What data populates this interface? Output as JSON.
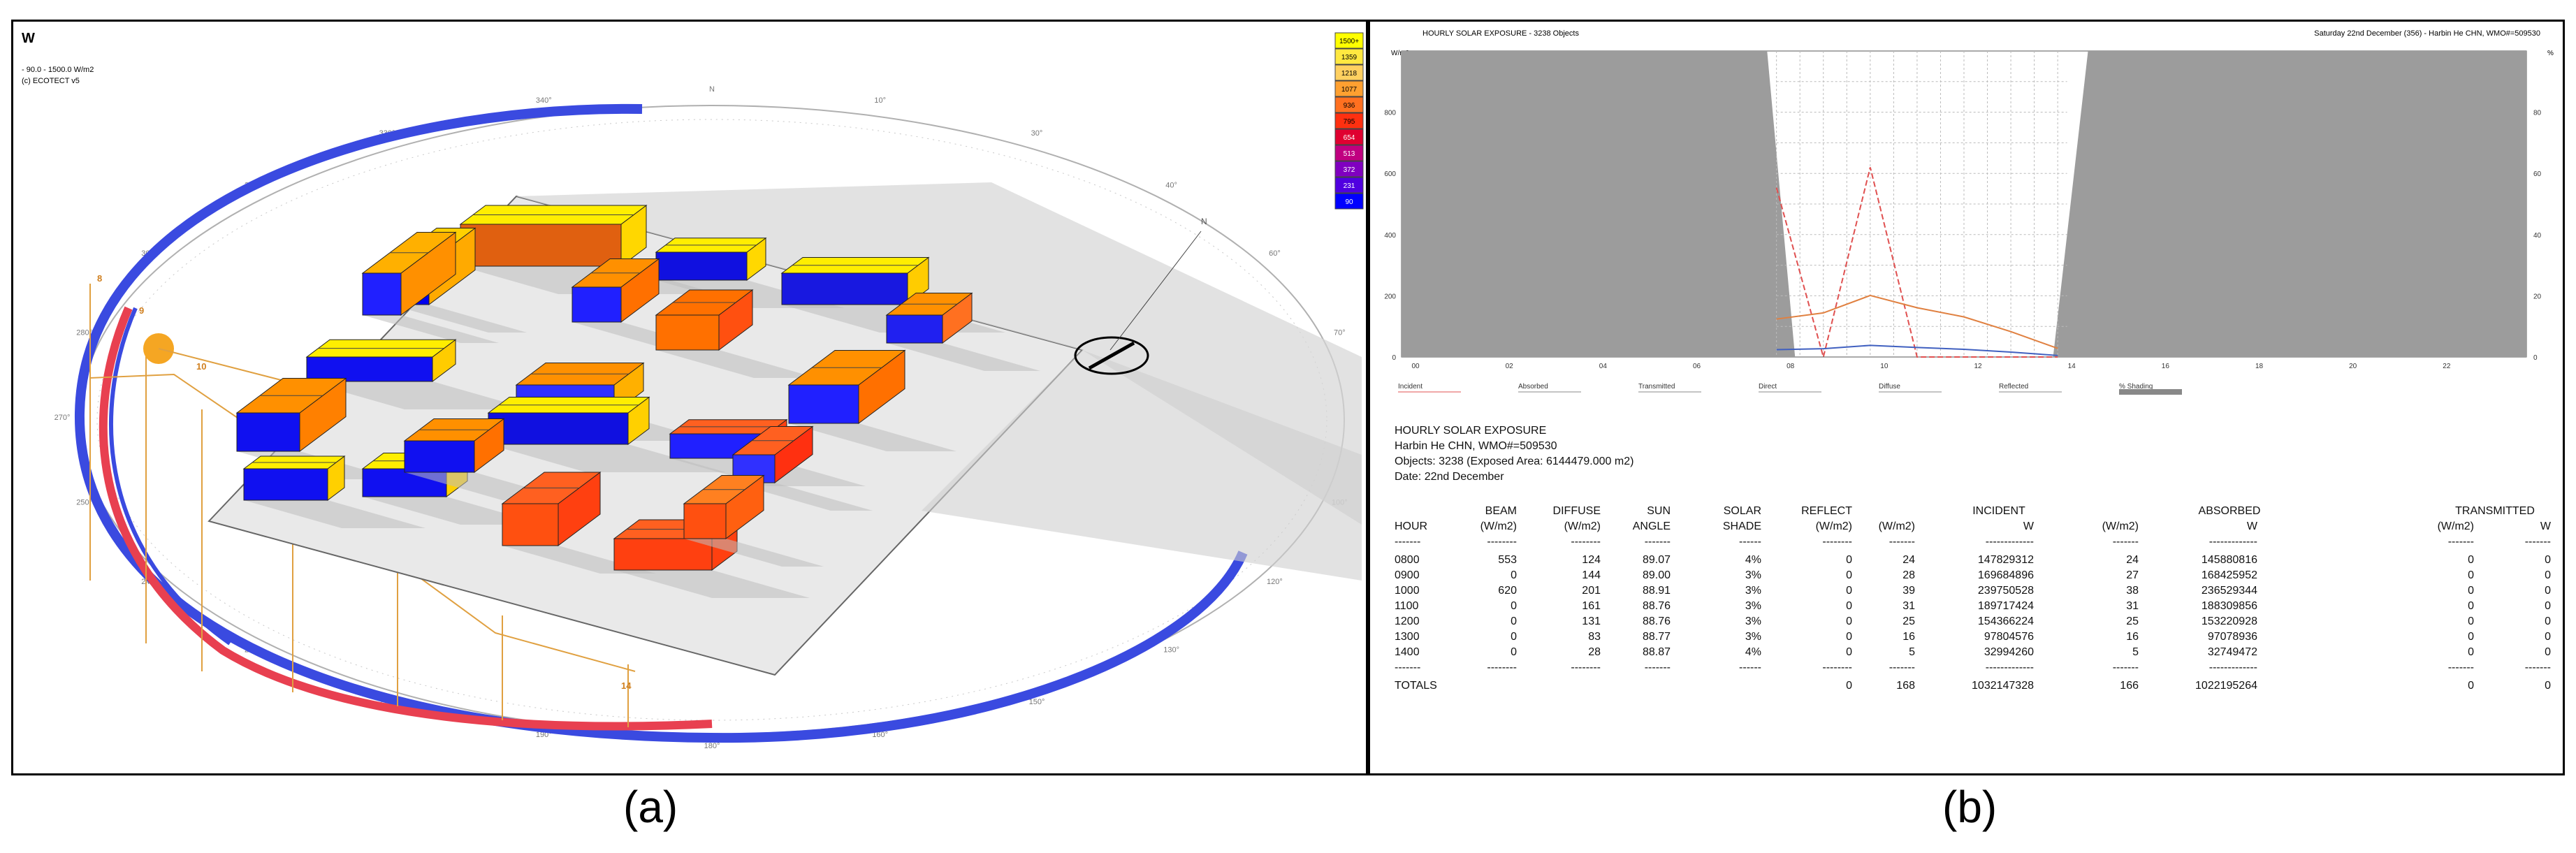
{
  "panel_a": {
    "corner_label": "W",
    "range_text": "- 90.0 - 1500.0 W/m2",
    "copyright_text": "(c) ECOTECT v5",
    "legend": [
      "1500+",
      "1359",
      "1218",
      "1077",
      "936",
      "795",
      "654",
      "513",
      "372",
      "231",
      "90"
    ],
    "legend_colors": [
      "#ffff00",
      "#ffe840",
      "#ffd060",
      "#ffa030",
      "#ff7020",
      "#ff3010",
      "#e00030",
      "#c00080",
      "#8000c0",
      "#5000e0",
      "#0000ff"
    ],
    "compass_labels": [
      "N",
      "10°",
      "30°",
      "40°",
      "60°",
      "70°",
      "90°",
      "100°",
      "120°",
      "130°",
      "150°",
      "160°",
      "180°",
      "190°",
      "210°",
      "220°",
      "240°",
      "250°",
      "270°",
      "280°",
      "300°",
      "310°",
      "330°",
      "340°"
    ],
    "sun_hour_labels": [
      "8",
      "9",
      "10",
      "11",
      "12",
      "13",
      "14"
    ],
    "sun_color": "#f5a623",
    "north_label": "N"
  },
  "panel_b": {
    "chart_header_left": "HOURLY SOLAR EXPOSURE - 3238 Objects",
    "chart_header_right": "Saturday 22nd December (356) - Harbin He CHN, WMO#=509530",
    "y_axis_unit": "W/m2",
    "y_axis_right_unit": "%",
    "chart_data": {
      "type": "line",
      "x": [
        0,
        2,
        4,
        6,
        8,
        10,
        12,
        14,
        16,
        18,
        20,
        22
      ],
      "x_tick_labels": [
        "00",
        "02",
        "04",
        "06",
        "08",
        "10",
        "12",
        "14",
        "16",
        "18",
        "20",
        "22"
      ],
      "y_left_ticks": [
        "0",
        "200",
        "400",
        "600",
        "800"
      ],
      "y_right_ticks": [
        "0",
        "20",
        "40",
        "60",
        "80"
      ],
      "ylim": [
        0,
        1000
      ],
      "series": [
        {
          "name": "Incident",
          "color": "#e05050",
          "hours": [
            8,
            9,
            10,
            11,
            12,
            13,
            14
          ],
          "values": [
            553,
            0,
            620,
            0,
            0,
            0,
            0
          ]
        },
        {
          "name": "Absorbed",
          "color": "#4060c0",
          "hours": [
            8,
            9,
            10,
            11,
            12,
            13,
            14
          ],
          "values": [
            24,
            27,
            38,
            31,
            25,
            16,
            5
          ]
        },
        {
          "name": "Diffuse",
          "color": "#e08040",
          "hours": [
            8,
            9,
            10,
            11,
            12,
            13,
            14
          ],
          "values": [
            124,
            144,
            201,
            161,
            131,
            83,
            28
          ]
        }
      ],
      "night_shading": [
        [
          0,
          7.8
        ],
        [
          14.2,
          24
        ]
      ],
      "legend": [
        "Incident",
        "Absorbed",
        "Transmitted",
        "Direct",
        "Diffuse",
        "Reflected",
        "% Shading"
      ]
    },
    "report": {
      "title": "HOURLY SOLAR EXPOSURE",
      "location": "Harbin He CHN, WMO#=509530",
      "objects": "Objects: 3238    (Exposed Area:  6144479.000 m2)",
      "date": "Date: 22nd December",
      "group_headers": {
        "incident": "INCIDENT",
        "absorbed": "ABSORBED",
        "transmitted": "TRANSMITTED"
      },
      "headers_top": [
        "",
        "BEAM",
        "DIFFUSE",
        "SUN",
        "SOLAR",
        "REFLECT",
        "",
        "",
        "",
        "",
        "",
        " "
      ],
      "headers_bottom": [
        "HOUR",
        "(W/m2)",
        "(W/m2)",
        "ANGLE",
        "SHADE",
        "(W/m2)",
        "(W/m2)",
        "W",
        "(W/m2)",
        "W",
        "(W/m2)",
        "W"
      ],
      "sep": [
        "-------",
        "--------",
        "--------",
        "-------",
        "------",
        "--------",
        "-------",
        "-------------",
        "-------",
        "-------------",
        "-------",
        "-------"
      ],
      "rows": [
        [
          "0800",
          "553",
          "124",
          "89.07",
          "4%",
          "0",
          "24",
          "147829312",
          "24",
          "145880816",
          "0",
          "0"
        ],
        [
          "0900",
          "0",
          "144",
          "89.00",
          "3%",
          "0",
          "28",
          "169684896",
          "27",
          "168425952",
          "0",
          "0"
        ],
        [
          "1000",
          "620",
          "201",
          "88.91",
          "3%",
          "0",
          "39",
          "239750528",
          "38",
          "236529344",
          "0",
          "0"
        ],
        [
          "1100",
          "0",
          "161",
          "88.76",
          "3%",
          "0",
          "31",
          "189717424",
          "31",
          "188309856",
          "0",
          "0"
        ],
        [
          "1200",
          "0",
          "131",
          "88.76",
          "3%",
          "0",
          "25",
          "154366224",
          "25",
          "153220928",
          "0",
          "0"
        ],
        [
          "1300",
          "0",
          "83",
          "88.77",
          "3%",
          "0",
          "16",
          "97804576",
          "16",
          "97078936",
          "0",
          "0"
        ],
        [
          "1400",
          "0",
          "28",
          "88.87",
          "4%",
          "0",
          "5",
          "32994260",
          "5",
          "32749472",
          "0",
          "0"
        ]
      ],
      "totals": [
        "TOTALS",
        "",
        "",
        "",
        "",
        "0",
        "168",
        "1032147328",
        "166",
        "1022195264",
        "0",
        "0"
      ]
    }
  },
  "captions": {
    "a": "(a)",
    "b": "(b)"
  }
}
